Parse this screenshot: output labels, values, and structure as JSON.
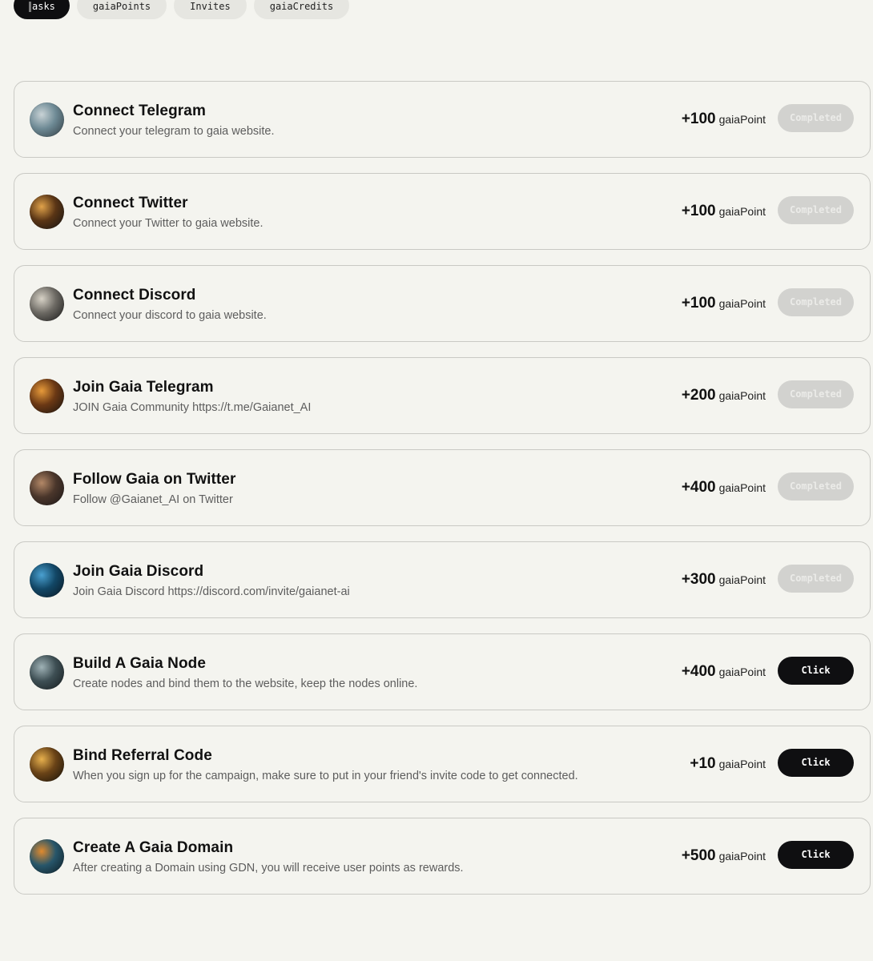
{
  "tabs": [
    {
      "label": "asks",
      "active": true
    },
    {
      "label": "gaiaPoints",
      "active": false
    },
    {
      "label": "Invites",
      "active": false
    },
    {
      "label": "gaiaCredits",
      "active": false
    }
  ],
  "points_unit": "gaiaPoint",
  "tasks": [
    {
      "title": "Connect Telegram",
      "desc": "Connect your telegram to gaia website.",
      "points": "+100",
      "button": "Completed",
      "status": "completed",
      "avatar_colors": [
        "#c9d3d6",
        "#6e8a95",
        "#2f3a40"
      ]
    },
    {
      "title": "Connect Twitter",
      "desc": "Connect your Twitter to gaia website.",
      "points": "+100",
      "button": "Completed",
      "status": "completed",
      "avatar_colors": [
        "#e0a24a",
        "#5a3515",
        "#121212"
      ]
    },
    {
      "title": "Connect Discord",
      "desc": "Connect your discord to gaia website.",
      "points": "+100",
      "button": "Completed",
      "status": "completed",
      "avatar_colors": [
        "#d7d2c6",
        "#6d6a64",
        "#161616"
      ]
    },
    {
      "title": "Join Gaia Telegram",
      "desc": "JOIN Gaia Community https://t.me/Gaianet_AI",
      "points": "+200",
      "button": "Completed",
      "status": "completed",
      "avatar_colors": [
        "#e79a3a",
        "#6b3814",
        "#171310"
      ]
    },
    {
      "title": "Follow Gaia on Twitter",
      "desc": "Follow @Gaianet_AI on Twitter",
      "points": "+400",
      "button": "Completed",
      "status": "completed",
      "avatar_colors": [
        "#b38867",
        "#4a362b",
        "#1b1717"
      ]
    },
    {
      "title": "Join Gaia Discord",
      "desc": "Join Gaia Discord https://discord.com/invite/gaianet-ai",
      "points": "+300",
      "button": "Completed",
      "status": "completed",
      "avatar_colors": [
        "#4aa0d0",
        "#124766",
        "#0a1620"
      ]
    },
    {
      "title": "Build A Gaia Node",
      "desc": "Create nodes and bind them to the website, keep the nodes online.",
      "points": "+400",
      "button": "Click",
      "status": "click",
      "avatar_colors": [
        "#9fb2b6",
        "#3e4f54",
        "#141a1c"
      ]
    },
    {
      "title": "Bind Referral Code",
      "desc": "When you sign up for the campaign, make sure to put in your friend's invite code to get connected.",
      "points": "+10",
      "button": "Click",
      "status": "click",
      "avatar_colors": [
        "#e7b04d",
        "#6a4317",
        "#141008"
      ]
    },
    {
      "title": "Create A Gaia Domain",
      "desc": "After creating a Domain using GDN, you will receive user points as rewards.",
      "points": "+500",
      "button": "Click",
      "status": "click",
      "avatar_colors": [
        "#e08a2e",
        "#27566a",
        "#0d1b23"
      ]
    }
  ]
}
